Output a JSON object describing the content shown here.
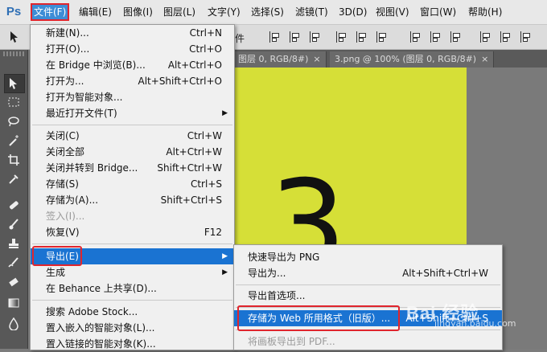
{
  "app": {
    "logo": "Ps"
  },
  "menubar": {
    "items": [
      {
        "label": "文件(F)"
      },
      {
        "label": "编辑(E)"
      },
      {
        "label": "图像(I)"
      },
      {
        "label": "图层(L)"
      },
      {
        "label": "文字(Y)"
      },
      {
        "label": "选择(S)"
      },
      {
        "label": "滤镜(T)"
      },
      {
        "label": "3D(D)"
      },
      {
        "label": "视图(V)"
      },
      {
        "label": "窗口(W)"
      },
      {
        "label": "帮助(H)"
      }
    ]
  },
  "options_bar": {
    "partial_text": "件"
  },
  "tabs": [
    {
      "label": "图层 0, RGB/8#)"
    },
    {
      "label": "3.png @ 100% (图层 0, RGB/8#)"
    }
  ],
  "canvas": {
    "digit": "3",
    "background": "#d6df37"
  },
  "file_menu": {
    "items": [
      {
        "label": "新建(N)...",
        "shortcut": "Ctrl+N"
      },
      {
        "label": "打开(O)...",
        "shortcut": "Ctrl+O"
      },
      {
        "label": "在 Bridge 中浏览(B)...",
        "shortcut": "Alt+Ctrl+O"
      },
      {
        "label": "打开为...",
        "shortcut": "Alt+Shift+Ctrl+O"
      },
      {
        "label": "打开为智能对象...",
        "shortcut": ""
      },
      {
        "label": "最近打开文件(T)",
        "shortcut": ""
      },
      {
        "label": "关闭(C)",
        "shortcut": "Ctrl+W"
      },
      {
        "label": "关闭全部",
        "shortcut": "Alt+Ctrl+W"
      },
      {
        "label": "关闭并转到 Bridge...",
        "shortcut": "Shift+Ctrl+W"
      },
      {
        "label": "存储(S)",
        "shortcut": "Ctrl+S"
      },
      {
        "label": "存储为(A)...",
        "shortcut": "Shift+Ctrl+S"
      },
      {
        "label": "签入(I)...",
        "shortcut": ""
      },
      {
        "label": "恢复(V)",
        "shortcut": "F12"
      },
      {
        "label": "导出(E)",
        "shortcut": ""
      },
      {
        "label": "生成",
        "shortcut": ""
      },
      {
        "label": "在 Behance 上共享(D)...",
        "shortcut": ""
      },
      {
        "label": "搜索 Adobe Stock...",
        "shortcut": ""
      },
      {
        "label": "置入嵌入的智能对象(L)...",
        "shortcut": ""
      },
      {
        "label": "置入链接的智能对象(K)...",
        "shortcut": ""
      }
    ]
  },
  "export_submenu": {
    "items": [
      {
        "label": "快速导出为 PNG",
        "shortcut": ""
      },
      {
        "label": "导出为...",
        "shortcut": "Alt+Shift+Ctrl+W"
      },
      {
        "label": "导出首选项...",
        "shortcut": ""
      },
      {
        "label": "存储为 Web 所用格式（旧版）...",
        "shortcut": "Alt+Shift+Ctrl+S"
      },
      {
        "label": "将画板导出到 PDF...",
        "shortcut": ""
      }
    ]
  },
  "watermark": {
    "text": "Bai 经验",
    "sub": "jingyan.baidu.com"
  }
}
